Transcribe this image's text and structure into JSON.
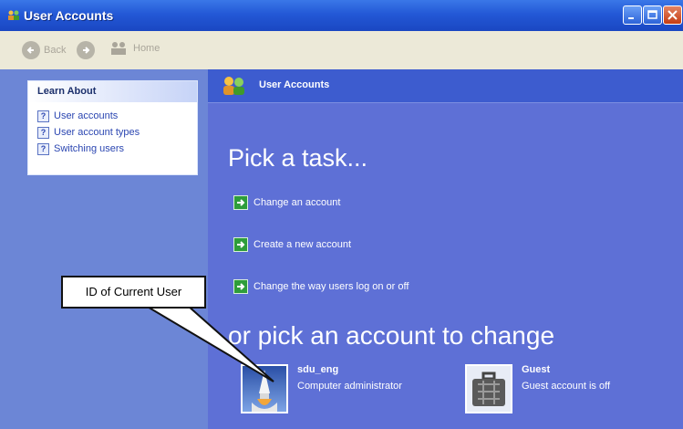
{
  "window": {
    "title": "User Accounts",
    "colors": {
      "titlebar": "#2358d6",
      "left_pane": "#6c86d6",
      "main_pane": "#5e70d6",
      "callout_bg": "#ffffff"
    }
  },
  "nav": {
    "back_label": "Back",
    "home_label": "Home"
  },
  "learn_about": {
    "heading": "Learn About",
    "items": [
      {
        "label": "User accounts",
        "icon": "help-icon"
      },
      {
        "label": "User account types",
        "icon": "help-icon"
      },
      {
        "label": "Switching users",
        "icon": "help-icon"
      }
    ]
  },
  "main": {
    "header": "User Accounts",
    "pick_task": "Pick a task...",
    "tasks": [
      {
        "label": "Change an account",
        "icon": "green-arrow-icon"
      },
      {
        "label": "Create a new account",
        "icon": "green-arrow-icon"
      },
      {
        "label": "Change the way users log on or off",
        "icon": "green-arrow-icon"
      }
    ],
    "pick_account": "or pick an account to change",
    "accounts": [
      {
        "name": "sdu_eng",
        "role": "Computer administrator",
        "icon": "space-shuttle-icon"
      },
      {
        "name": "Guest",
        "role": "Guest account is off",
        "icon": "briefcase-icon"
      }
    ]
  },
  "callout": {
    "text": "ID of Current User"
  }
}
